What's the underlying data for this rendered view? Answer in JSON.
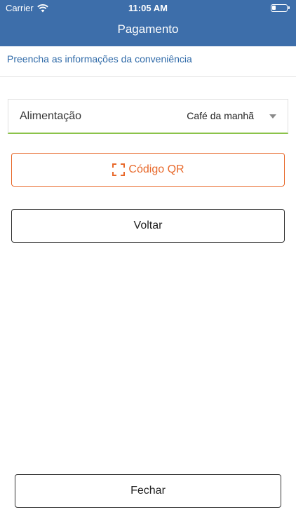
{
  "status_bar": {
    "carrier": "Carrier",
    "time": "11:05 AM",
    "wifi_icon": "wifi-icon",
    "battery_icon": "battery-icon"
  },
  "header": {
    "title": "Pagamento",
    "background_color": "#3d6eaa"
  },
  "subtitle": "Preencha as informações da conveniência",
  "meal_select": {
    "label": "Alimentação",
    "selected_value": "Café da manhã",
    "icon": "chevron-down-icon",
    "accent_color": "#8bc34a"
  },
  "qr_button": {
    "label": "Código QR",
    "icon": "qr-scan-icon",
    "color": "#e8692b"
  },
  "back_button": {
    "label": "Voltar"
  },
  "close_button": {
    "label": "Fechar"
  }
}
